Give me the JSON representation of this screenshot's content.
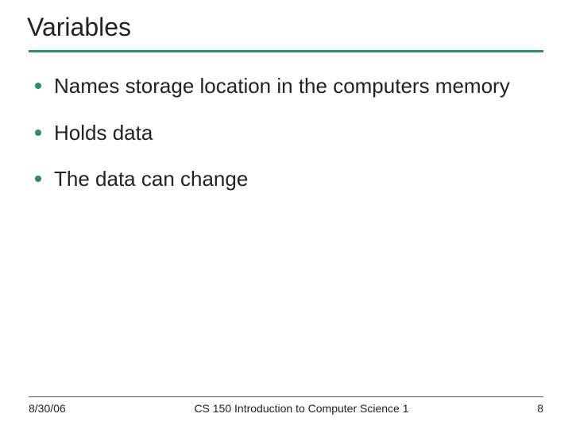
{
  "title": "Variables",
  "bullets": [
    "Names storage location in the computers memory",
    "Holds data",
    "The data can change"
  ],
  "footer": {
    "date": "8/30/06",
    "course": "CS 150 Introduction to Computer Science 1",
    "page": "8"
  }
}
